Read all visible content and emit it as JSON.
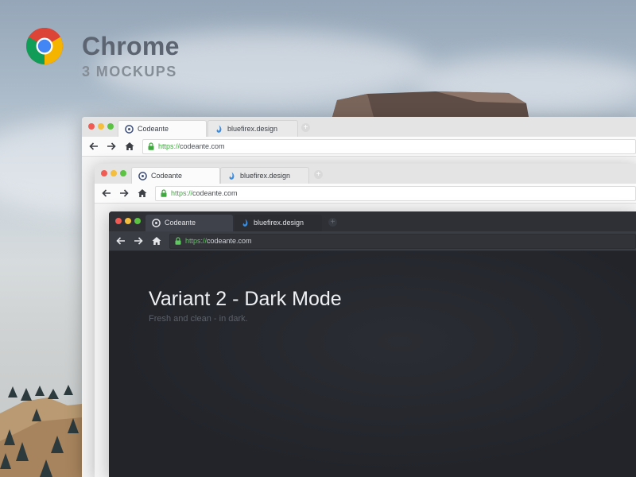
{
  "branding": {
    "title": "Chrome",
    "subtitle": "3 MOCKUPS"
  },
  "windows": [
    {
      "theme": "light",
      "tabs": [
        {
          "label": "Codeante",
          "active": true,
          "icon": "codeante-favicon"
        },
        {
          "label": "bluefirex.design",
          "active": false,
          "icon": "bluefirex-favicon"
        }
      ],
      "url_protocol": "https://",
      "url_host": "codeante.com"
    },
    {
      "theme": "light",
      "tabs": [
        {
          "label": "Codeante",
          "active": true,
          "icon": "codeante-favicon"
        },
        {
          "label": "bluefirex.design",
          "active": false,
          "icon": "bluefirex-favicon"
        }
      ],
      "url_protocol": "https://",
      "url_host": "codeante.com"
    },
    {
      "theme": "dark",
      "tabs": [
        {
          "label": "Codeante",
          "active": true,
          "icon": "codeante-favicon"
        },
        {
          "label": "bluefirex.design",
          "active": false,
          "icon": "bluefirex-favicon"
        }
      ],
      "url_protocol": "https://",
      "url_host": "codeante.com",
      "content": {
        "heading": "Variant 2 - Dark Mode",
        "tagline": "Fresh and clean - in dark."
      }
    }
  ],
  "icons": {
    "back": "back-arrow-icon",
    "forward": "forward-arrow-icon",
    "home": "home-icon",
    "lock": "lock-icon",
    "new_tab": "new-tab-icon",
    "new_tab_glyph": "+"
  },
  "colors": {
    "close_dot": "#f05b53",
    "minimize_dot": "#f4be3f",
    "maximize_dot": "#5bc243",
    "secure_green": "#3fa83f",
    "dark_bg": "#25272c"
  }
}
